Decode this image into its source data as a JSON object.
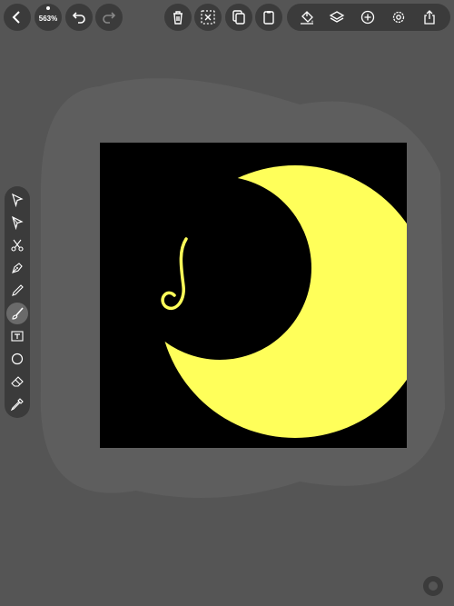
{
  "toolbar_top": {
    "zoom_label": "563%"
  },
  "colors": {
    "background": "#555555",
    "button_bg": "#3b3b3b",
    "artboard_bg": "#000000",
    "moon_fill": "#ffff5a",
    "icon_color": "#ffffff"
  },
  "icons": {
    "back": "chevron-left-icon",
    "undo": "undo-icon",
    "redo": "redo-icon",
    "delete": "trash-icon",
    "deselect": "deselect-icon",
    "copy": "copy-icon",
    "paste": "clipboard-icon",
    "style": "paint-bucket-icon",
    "layers": "layers-icon",
    "add": "plus-icon",
    "settings": "gear-icon",
    "share": "share-icon"
  },
  "tools": [
    {
      "name": "selection-tool-icon",
      "active": false
    },
    {
      "name": "direct-select-tool-icon",
      "active": false
    },
    {
      "name": "scissors-tool-icon",
      "active": false
    },
    {
      "name": "pen-tool-icon",
      "active": false
    },
    {
      "name": "pencil-tool-icon",
      "active": false
    },
    {
      "name": "brush-tool-icon",
      "active": true
    },
    {
      "name": "text-tool-icon",
      "active": false
    },
    {
      "name": "ellipse-tool-icon",
      "active": false
    },
    {
      "name": "eraser-tool-icon",
      "active": false
    },
    {
      "name": "eyedropper-tool-icon",
      "active": false
    }
  ]
}
